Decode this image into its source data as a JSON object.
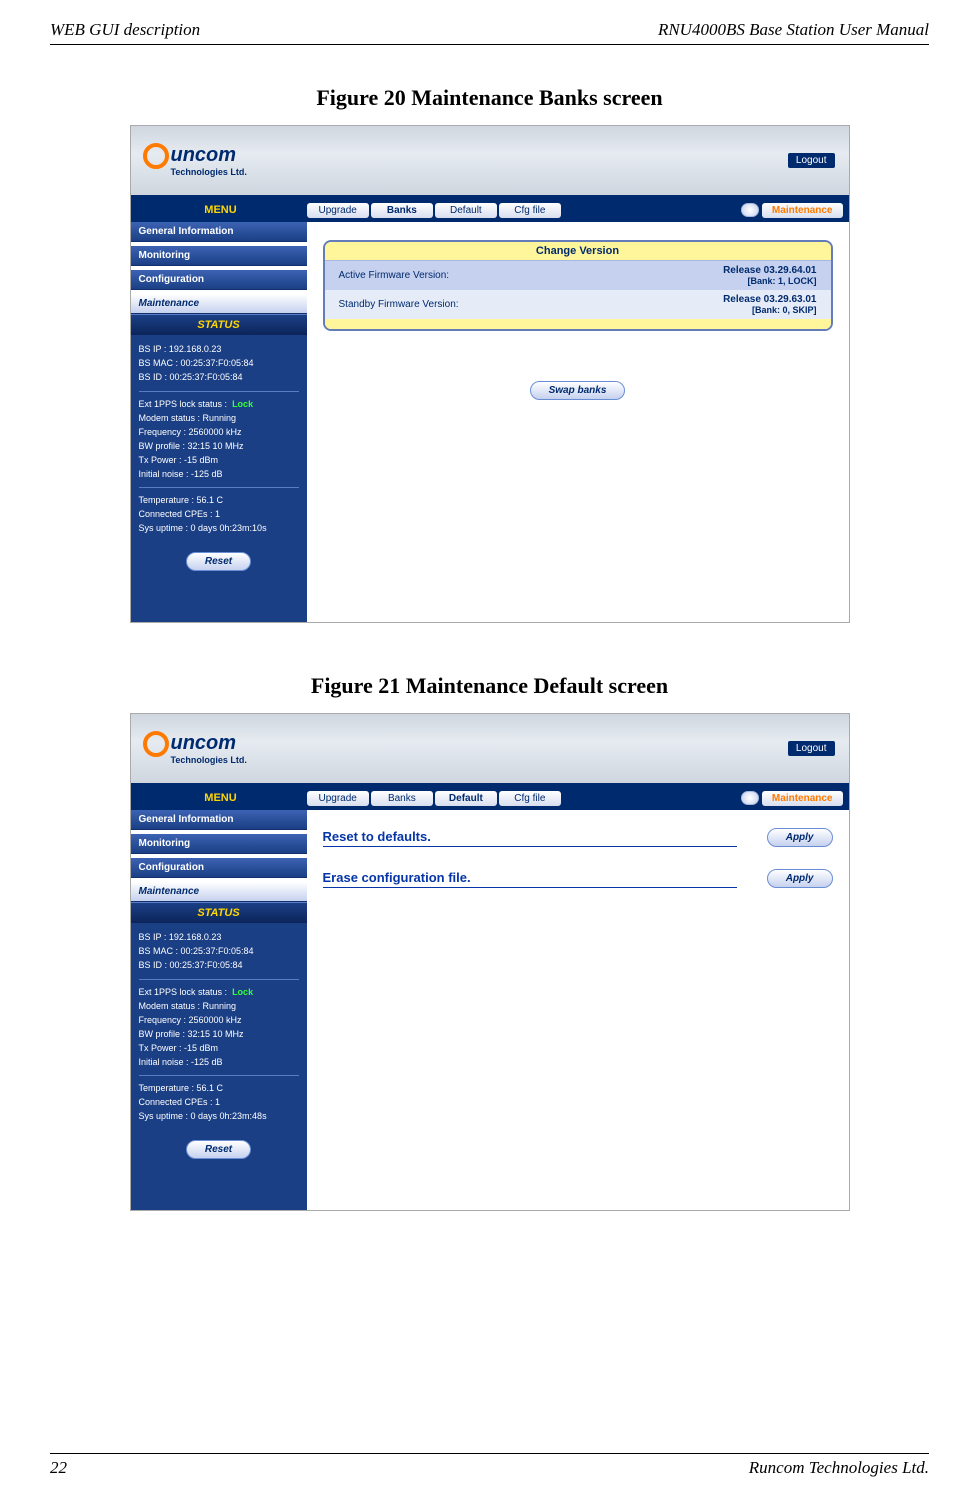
{
  "header": {
    "left": "WEB GUI description",
    "right": "RNU4000BS Base Station User Manual"
  },
  "footer": {
    "left": "22",
    "right": "Runcom Technologies Ltd."
  },
  "fig20": {
    "caption": "Figure 20   Maintenance Banks screen"
  },
  "fig21": {
    "caption": "Figure 21   Maintenance Default screen"
  },
  "logo": {
    "main": "uncom",
    "sub": "Technologies Ltd."
  },
  "logout": "Logout",
  "menulabel": "MENU",
  "tabs": {
    "upgrade": "Upgrade",
    "banks": "Banks",
    "default": "Default",
    "cfg": "Cfg file"
  },
  "indicator": "Maintenance",
  "nav": {
    "gi": "General Information",
    "mon": "Monitoring",
    "conf": "Configuration",
    "maint": "Maintenance"
  },
  "status_header": "STATUS",
  "status_a": {
    "ip": "BS IP :  192.168.0.23",
    "mac": "BS MAC :  00:25:37:F0:05:84",
    "id": "BS ID :  00:25:37:F0:05:84",
    "pps_label": "Ext 1PPS lock status :",
    "pps_val": "Lock",
    "modem": "Modem status :  Running",
    "freq": "Frequency :  2560000 kHz",
    "bw": "BW profile :  32:15 10 MHz",
    "tx": "Tx Power :  -15 dBm",
    "noise": "Initial noise :  -125 dB",
    "temp": "Temperature :  56.1 C",
    "cpes": "Connected CPEs :  1",
    "uptime": "Sys uptime :  0 days 0h:23m:10s"
  },
  "status_b": {
    "uptime": "Sys uptime :  0 days 0h:23m:48s"
  },
  "reset": "Reset",
  "change": {
    "title": "Change Version",
    "row1_label": "Active Firmware Version:",
    "row1_val": "Release 03.29.64.01",
    "row1_sub": "[Bank: 1, LOCK]",
    "row2_label": "Standby Firmware Version:",
    "row2_val": "Release 03.29.63.01",
    "row2_sub": "[Bank: 0, SKIP]"
  },
  "swap": "Swap banks",
  "default_sections": {
    "reset": "Reset to defaults.",
    "erase": "Erase configuration file.",
    "apply": "Apply"
  }
}
